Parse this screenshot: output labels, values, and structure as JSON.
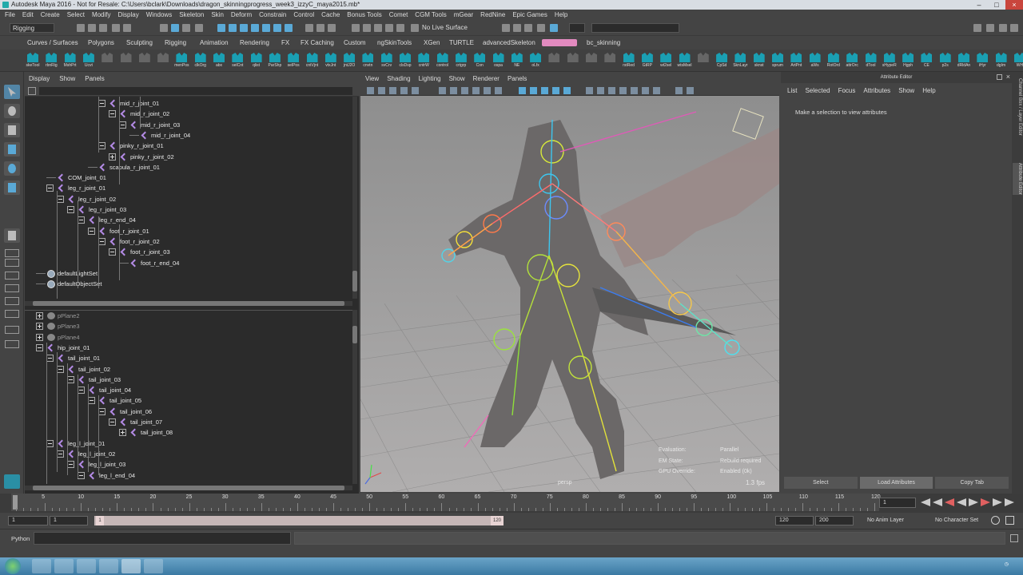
{
  "window": {
    "title": "Autodesk Maya 2016 - Not for Resale: C:\\Users\\bclark\\Downloads\\dragon_skinningprogress_week3_izzyC_maya2015.mb*"
  },
  "menubar": [
    "File",
    "Edit",
    "Create",
    "Select",
    "Modify",
    "Display",
    "Windows",
    "Skeleton",
    "Skin",
    "Deform",
    "Constrain",
    "Control",
    "Cache",
    "Bonus Tools",
    "Comet",
    "CGM Tools",
    "mGear",
    "RedNine",
    "Epic Games",
    "Help"
  ],
  "status": {
    "mode": "Rigging",
    "live_surface": "No Live Surface"
  },
  "shelf_tabs": [
    "Curves / Surfaces",
    "Polygons",
    "Sculpting",
    "Rigging",
    "Animation",
    "Rendering",
    "FX",
    "FX Caching",
    "Custom",
    "ngSkinTools",
    "XGen",
    "TURTLE",
    "advancedSkeleton",
    "",
    "bc_skinning"
  ],
  "shelf_active_index": 13,
  "shelf_buttons": [
    "skeTool",
    "rbnRig",
    "MshPrt",
    "Ucvt",
    "",
    "",
    "",
    "",
    "menPos",
    "clkOrg",
    "abx",
    "selCnt",
    "qlist",
    "ParShp",
    "selPos",
    "cntVjnt",
    "vtxJnt",
    "jntJ2O",
    "cnvtn",
    "svCrv",
    "clsDsp",
    "cntrW",
    "control",
    "crtgrp",
    "Con",
    "ospa",
    "NE",
    "oLfx",
    "",
    "",
    "",
    "",
    "rstRed",
    "GtRP",
    "wt2sel",
    "wtsMsel",
    "",
    "CpSd",
    "SknLayr",
    "sknst",
    "sprum",
    "ArtPnt",
    "aWs",
    "RotOrd",
    "attrOrc",
    "dTool",
    "sHypeR",
    "Hgph",
    "CE",
    "p2s",
    "dRldAn",
    "iHyr",
    "dgIm",
    "WH"
  ],
  "outliner": {
    "menu": [
      "Display",
      "Show",
      "Panels"
    ],
    "top_rows": [
      {
        "label": "mid_r_joint_01",
        "indent": 6,
        "exp": "minus",
        "icon": "joint"
      },
      {
        "label": "mid_r_joint_02",
        "indent": 7,
        "exp": "minus",
        "icon": "joint"
      },
      {
        "label": "mid_r_joint_03",
        "indent": 8,
        "exp": "minus",
        "icon": "joint"
      },
      {
        "label": "mid_r_joint_04",
        "indent": 9,
        "exp": "none",
        "icon": "joint"
      },
      {
        "label": "pinky_r_joint_01",
        "indent": 6,
        "exp": "minus",
        "icon": "joint"
      },
      {
        "label": "pinky_r_joint_02",
        "indent": 7,
        "exp": "plus",
        "icon": "joint"
      },
      {
        "label": "scapula_r_joint_01",
        "indent": 5,
        "exp": "none",
        "icon": "joint"
      },
      {
        "label": "COM_joint_01",
        "indent": 1,
        "exp": "none",
        "icon": "joint"
      },
      {
        "label": "leg_r_joint_01",
        "indent": 1,
        "exp": "minus",
        "icon": "joint"
      },
      {
        "label": "leg_r_joint_02",
        "indent": 2,
        "exp": "minus",
        "icon": "joint"
      },
      {
        "label": "leg_r_joint_03",
        "indent": 3,
        "exp": "minus",
        "icon": "joint"
      },
      {
        "label": "leg_r_end_04",
        "indent": 4,
        "exp": "minus",
        "icon": "joint"
      },
      {
        "label": "foot_r_joint_01",
        "indent": 5,
        "exp": "minus",
        "icon": "joint"
      },
      {
        "label": "foot_r_joint_02",
        "indent": 6,
        "exp": "minus",
        "icon": "joint"
      },
      {
        "label": "foot_r_joint_03",
        "indent": 7,
        "exp": "minus",
        "icon": "joint"
      },
      {
        "label": "foot_r_end_04",
        "indent": 8,
        "exp": "none",
        "icon": "joint"
      },
      {
        "label": "defaultLightSet",
        "indent": 0,
        "exp": "none",
        "icon": "set"
      },
      {
        "label": "defaultObjectSet",
        "indent": 0,
        "exp": "none",
        "icon": "set"
      }
    ],
    "bottom_rows": [
      {
        "label": "pPlane2",
        "indent": 0,
        "exp": "plus",
        "icon": "mesh"
      },
      {
        "label": "pPlane3",
        "indent": 0,
        "exp": "plus",
        "icon": "mesh"
      },
      {
        "label": "pPlane4",
        "indent": 0,
        "exp": "plus",
        "icon": "mesh"
      },
      {
        "label": "hip_joint_01",
        "indent": 0,
        "exp": "minus",
        "icon": "joint"
      },
      {
        "label": "tail_joint_01",
        "indent": 1,
        "exp": "minus",
        "icon": "joint"
      },
      {
        "label": "tail_joint_02",
        "indent": 2,
        "exp": "minus",
        "icon": "joint"
      },
      {
        "label": "tail_joint_03",
        "indent": 3,
        "exp": "minus",
        "icon": "joint"
      },
      {
        "label": "tail_joint_04",
        "indent": 4,
        "exp": "minus",
        "icon": "joint"
      },
      {
        "label": "tail_joint_05",
        "indent": 5,
        "exp": "minus",
        "icon": "joint"
      },
      {
        "label": "tail_joint_06",
        "indent": 6,
        "exp": "minus",
        "icon": "joint"
      },
      {
        "label": "tail_joint_07",
        "indent": 7,
        "exp": "minus",
        "icon": "joint"
      },
      {
        "label": "tail_joint_08",
        "indent": 8,
        "exp": "plus",
        "icon": "joint"
      },
      {
        "label": "leg_l_joint_01",
        "indent": 1,
        "exp": "minus",
        "icon": "joint"
      },
      {
        "label": "leg_l_joint_02",
        "indent": 2,
        "exp": "minus",
        "icon": "joint"
      },
      {
        "label": "leg_l_joint_03",
        "indent": 3,
        "exp": "minus",
        "icon": "joint"
      },
      {
        "label": "leg_l_end_04",
        "indent": 4,
        "exp": "minus",
        "icon": "joint"
      }
    ]
  },
  "viewport": {
    "menu": [
      "View",
      "Shading",
      "Lighting",
      "Show",
      "Renderer",
      "Panels"
    ],
    "camera": "persp",
    "hud": [
      {
        "label": "Evaluation:",
        "value": "Parallel"
      },
      {
        "label": "EM State:",
        "value": "Rebuild required"
      },
      {
        "label": "GPU Override:",
        "value": "Enabled (0k)"
      }
    ],
    "fps": "1.3 fps"
  },
  "attribute_editor": {
    "title": "Attribute Editor",
    "menu": [
      "List",
      "Selected",
      "Focus",
      "Attributes",
      "Show",
      "Help"
    ],
    "message": "Make a selection to view attributes",
    "buttons": [
      "Select",
      "Load Attributes",
      "Copy Tab"
    ]
  },
  "side_tabs": [
    "Channel Box / Layer Editor",
    "Attribute Editor"
  ],
  "timeline": {
    "ticks": [
      5,
      10,
      15,
      20,
      25,
      30,
      35,
      40,
      45,
      50,
      55,
      60,
      65,
      70,
      75,
      80,
      85,
      90,
      95,
      100,
      105,
      110,
      115,
      120
    ],
    "start": 1,
    "end": 120,
    "current_frame": "1"
  },
  "range": {
    "start": "1",
    "inner_start": "1",
    "inner_start_label": "1",
    "inner_end_label": "120",
    "end": "120",
    "max": "200",
    "anim_layer": "No Anim Layer",
    "character_set": "No Character Set"
  },
  "command": {
    "label": "Python"
  },
  "colors": {
    "ui_bg": "#444444",
    "outliner_bg": "#2b2b2b",
    "accent_pink": "#e38bc0",
    "shelf_icon": "#1a9fb3",
    "selected_tool": "#5285a6"
  }
}
